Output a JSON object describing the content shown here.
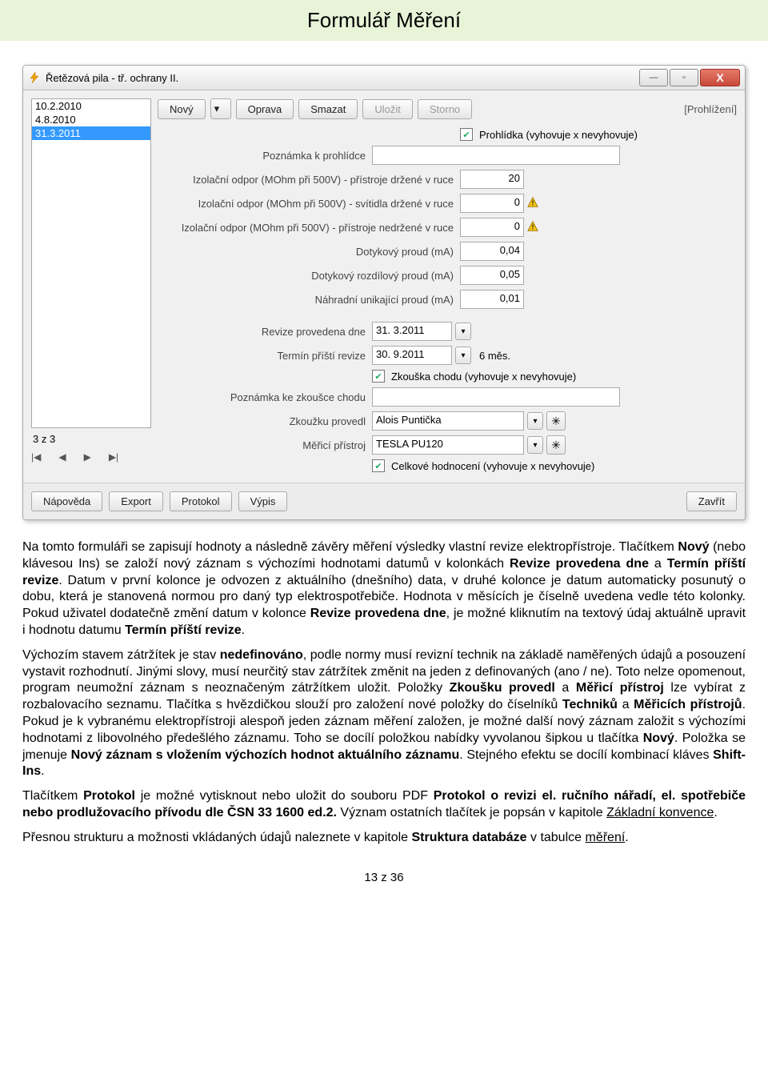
{
  "doc_title": "Formulář Měření",
  "window": {
    "title": "Řetězová pila - tř. ochrany II.",
    "min": "—",
    "max": "▫",
    "close": "X"
  },
  "listbox": {
    "items": [
      "10.2.2010",
      "4.8.2010",
      "31.3.2011"
    ],
    "selected_index": 2
  },
  "status": {
    "count": "3 z 3"
  },
  "nav": {
    "first": "|◀",
    "prev": "◀",
    "next": "▶",
    "last": "▶|"
  },
  "toolbar": {
    "novy": "Nový",
    "oprava": "Oprava",
    "smazat": "Smazat",
    "ulozit": "Uložit",
    "storno": "Storno",
    "mode": "[Prohlížení]"
  },
  "form": {
    "prohlidka_label": "Prohlídka (vyhovuje x nevyhovuje)",
    "poznamka_label": "Poznámka k prohlídce",
    "poznamka_value": "",
    "izo1_label": "Izolační odpor (MOhm při 500V) - přístroje držené v ruce",
    "izo1_value": "20",
    "izo2_label": "Izolační odpor (MOhm při 500V) - svítidla držené v ruce",
    "izo2_value": "0",
    "izo3_label": "Izolační odpor (MOhm při 500V) - přístroje nedržené v ruce",
    "izo3_value": "0",
    "dot_label": "Dotykový proud (mA)",
    "dot_value": "0,04",
    "dotroz_label": "Dotykový rozdílový proud (mA)",
    "dotroz_value": "0,05",
    "nahr_label": "Náhradní unikající proud (mA)",
    "nahr_value": "0,01",
    "revize_dne_label": "Revize provedena dne",
    "revize_dne_value": "31. 3.2011",
    "termin_label": "Termín příští revize",
    "termin_value": "30. 9.2011",
    "termin_months": "6 měs.",
    "zkouska_label": "Zkouška chodu (vyhovuje x nevyhovuje)",
    "poznamka_zk_label": "Poznámka ke zkoušce chodu",
    "poznamka_zk_value": "",
    "zkousku_label": "Zkoužku provedl",
    "zkousku_value": "Alois Puntička",
    "merici_label": "Měřicí přístroj",
    "merici_value": "TESLA PU120",
    "celkove_label": "Celkové hodnocení (vyhovuje x nevyhovuje)"
  },
  "bottom_toolbar": {
    "napoveda": "Nápověda",
    "export": "Export",
    "protokol": "Protokol",
    "vypis": "Výpis",
    "zavrit": "Zavřít"
  },
  "paragraphs": {
    "p1_a": "Na tomto formuláři se zapisují hodnoty a následně závěry měření výsledky vlastní revize elektropřístroje. Tlačítkem ",
    "p1_b1": "Nový",
    "p1_c": " (nebo klávesou Ins) se založí nový záznam s výchozími hodnotami datumů v kolonkách ",
    "p1_b2": "Revize provedena dne",
    "p1_d": " a ",
    "p1_b3": "Termín příští revize",
    "p1_e": ". Datum v první kolonce je odvozen z aktuálního (dnešního) data, v druhé kolonce je datum automaticky posunutý o dobu, která je stanovená normou pro daný typ elektrospotřebiče. Hodnota v měsících je číselně uvedena vedle této kolonky. Pokud uživatel dodatečně změní datum v kolonce ",
    "p1_b4": "Revize provedena dne",
    "p1_f": ", je možné kliknutím na textový údaj aktuálně upravit i hodnotu datumu ",
    "p1_b5": "Termín příští revize",
    "p1_g": ".",
    "p2_a": "Výchozím stavem zátržítek je stav ",
    "p2_b1": "nedefinováno",
    "p2_b": ", podle normy musí revizní technik na základě naměřených údajů a posouzení vystavit rozhodnutí. Jinými slovy, musí neurčitý stav zátržítek změnit na jeden z definovaných (ano / ne). Toto nelze opomenout, program neumožní záznam s neoznačeným zátržítkem uložit. Položky ",
    "p2_b2": "Zkoušku provedl",
    "p2_c": " a ",
    "p2_b3": "Měřicí přístroj",
    "p2_d": " lze vybírat z rozbalovacího seznamu. Tlačítka s hvězdičkou slouží pro založení nové položky do číselníků ",
    "p2_b4": "Techniků",
    "p2_e": " a ",
    "p2_b5": "Měřicích přístrojů",
    "p2_f": ". Pokud je k vybranému elektropřístroji alespoň jeden záznam měření založen, je možné další nový záznam založit s výchozími hodnotami z libovolného předešlého záznamu. Toho se docílí položkou nabídky vyvolanou šipkou u tlačítka ",
    "p2_b6": "Nový",
    "p2_g": ". Položka se jmenuje ",
    "p2_b7": "Nový záznam s vložením výchozích hodnot aktuálního záznamu",
    "p2_h": ". Stejného efektu se docílí kombinací kláves ",
    "p2_b8": "Shift-Ins",
    "p2_i": ".",
    "p3_a": "Tlačítkem ",
    "p3_b1": "Protokol",
    "p3_b": " je možné vytisknout nebo uložit do souboru PDF ",
    "p3_b2": "Protokol o revizi el. ručního nářadí, el. spotřebiče nebo prodlužovacího přívodu dle ČSN 33 1600 ed.2.",
    "p3_c": " Význam ostatních tlačítek je popsán v kapitole ",
    "p3_link": "Základní konvence",
    "p3_d": ".",
    "p4_a": "Přesnou strukturu a možnosti vkládaných údajů naleznete v kapitole ",
    "p4_b1": "Struktura databáze",
    "p4_b": " v tabulce ",
    "p4_link": "měření",
    "p4_c": "."
  },
  "footer": "13 z 36"
}
